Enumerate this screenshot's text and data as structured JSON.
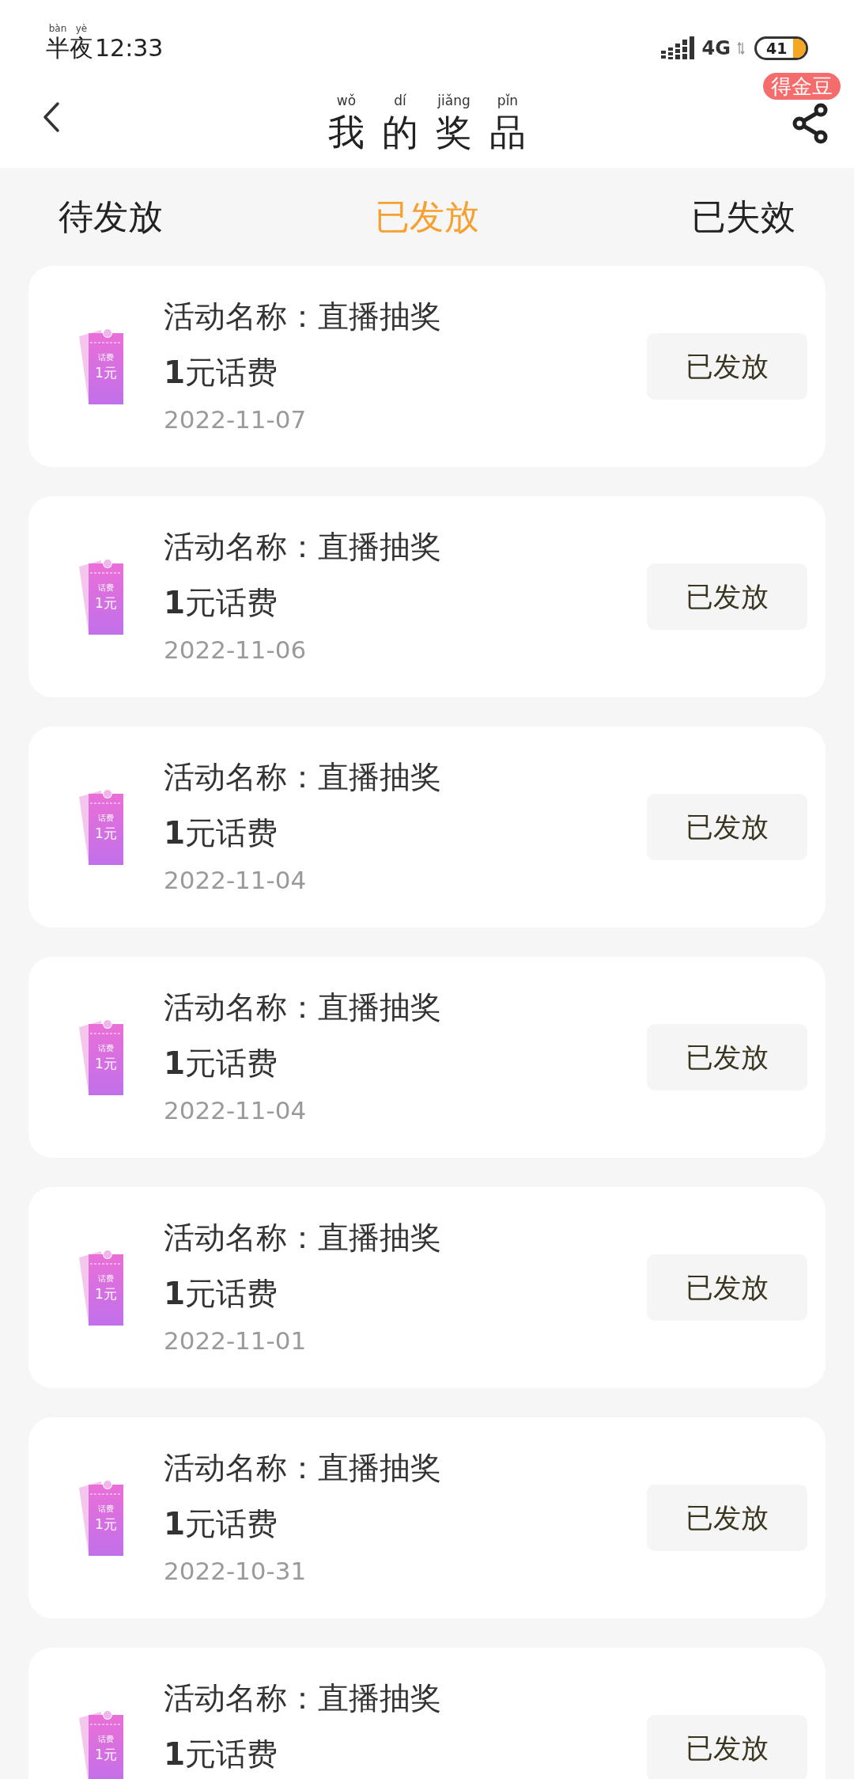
{
  "status_bar": {
    "period": [
      {
        "char": "半",
        "pinyin": "bàn"
      },
      {
        "char": "夜",
        "pinyin": "yè"
      }
    ],
    "time": "12:33",
    "network": "4G",
    "battery": "41"
  },
  "header": {
    "title": [
      {
        "char": "我",
        "pinyin": "wǒ"
      },
      {
        "char": "的",
        "pinyin": "dí"
      },
      {
        "char": "奖",
        "pinyin": "jiǎng"
      },
      {
        "char": "品",
        "pinyin": "pǐn"
      }
    ],
    "badge": "得金豆"
  },
  "tabs": [
    {
      "label": "待发放",
      "selected": false
    },
    {
      "label": "已发放",
      "selected": true
    },
    {
      "label": "已失效",
      "selected": false
    }
  ],
  "prizes": [
    {
      "ticket_label": "话费",
      "ticket_value": "1元",
      "activity": "活动名称：直播抽奖",
      "prize": "**1**元话费",
      "date": "2022-11-07",
      "status": "已发放"
    },
    {
      "ticket_label": "话费",
      "ticket_value": "1元",
      "activity": "活动名称：直播抽奖",
      "prize": "**1**元话费",
      "date": "2022-11-06",
      "status": "已发放"
    },
    {
      "ticket_label": "话费",
      "ticket_value": "1元",
      "activity": "活动名称：直播抽奖",
      "prize": "**1**元话费",
      "date": "2022-11-04",
      "status": "已发放"
    },
    {
      "ticket_label": "话费",
      "ticket_value": "1元",
      "activity": "活动名称：直播抽奖",
      "prize": "**1**元话费",
      "date": "2022-11-04",
      "status": "已发放"
    },
    {
      "ticket_label": "话费",
      "ticket_value": "1元",
      "activity": "活动名称：直播抽奖",
      "prize": "**1**元话费",
      "date": "2022-11-01",
      "status": "已发放"
    },
    {
      "ticket_label": "话费",
      "ticket_value": "1元",
      "activity": "活动名称：直播抽奖",
      "prize": "**1**元话费",
      "date": "2022-10-31",
      "status": "已发放"
    },
    {
      "ticket_label": "话费",
      "ticket_value": "1元",
      "activity": "活动名称：直播抽奖",
      "prize": "**1**元话费",
      "status": "已发放"
    }
  ]
}
